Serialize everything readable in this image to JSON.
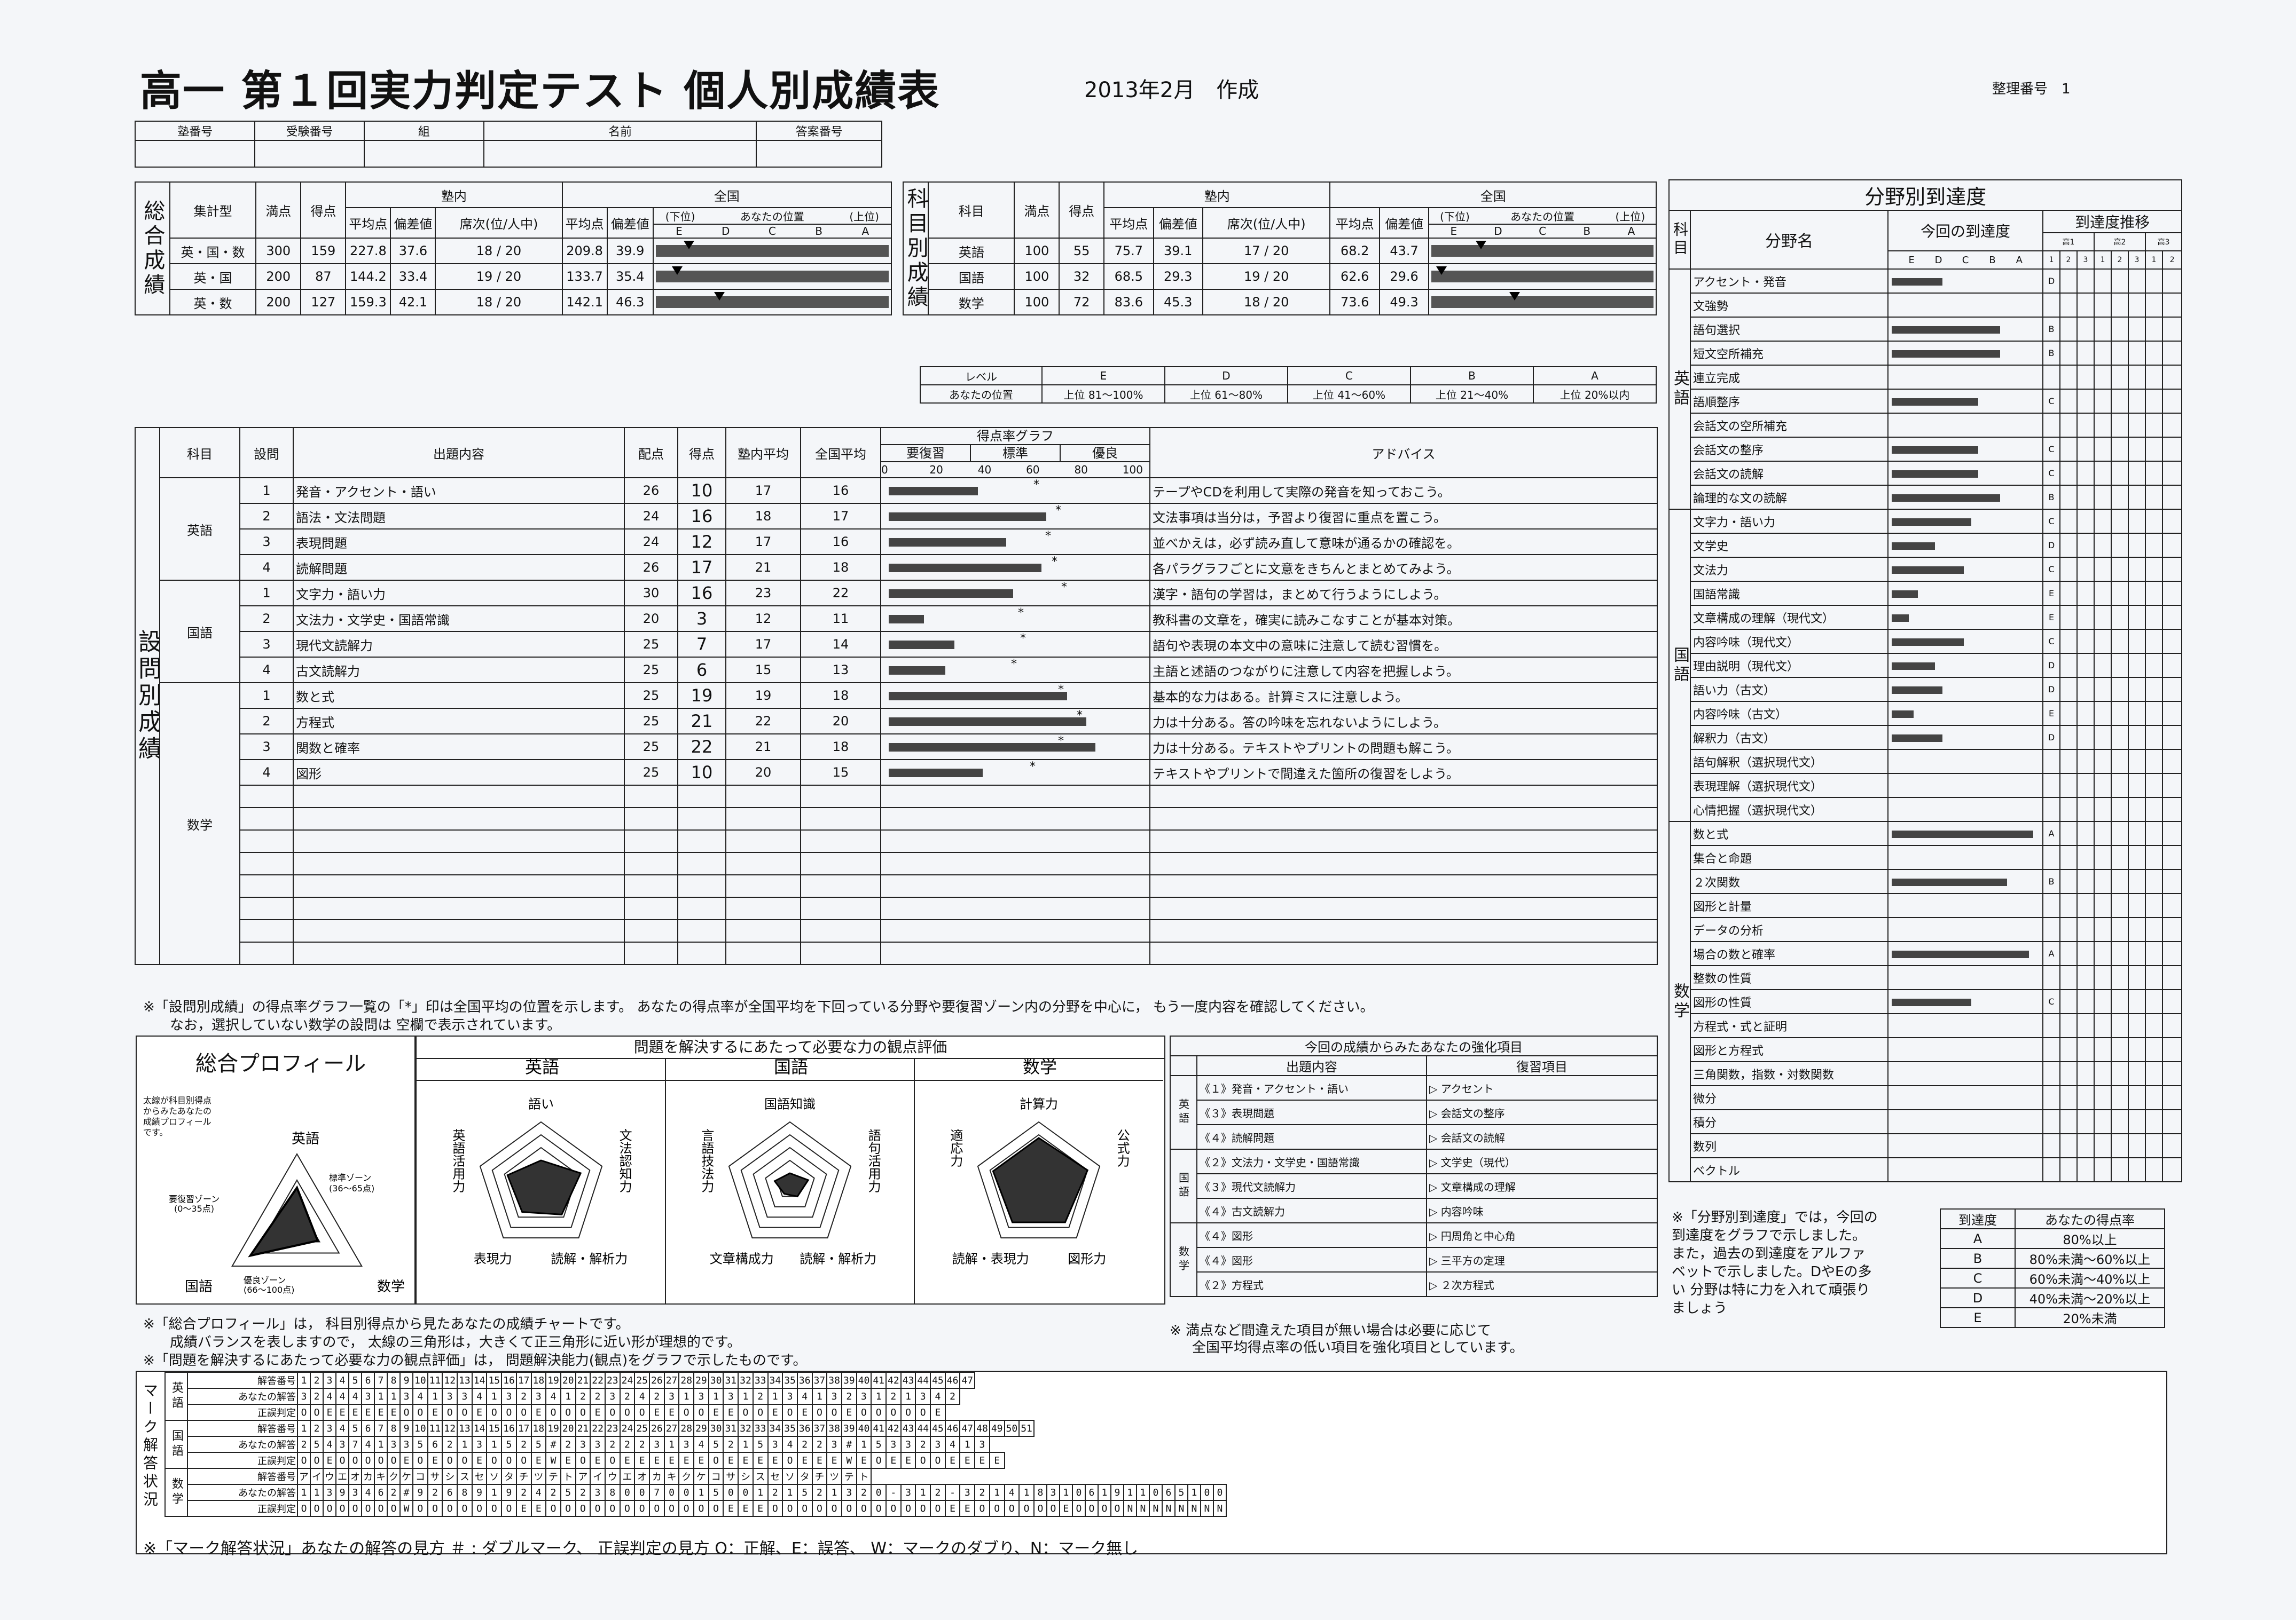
{
  "header": {
    "title": "高一 第１回実力判定テスト 個人別成績表",
    "date": "2013年2月　作成",
    "ref_label": "整理番号",
    "ref_value": "1"
  },
  "id_fields": [
    "塾番号",
    "受験番号",
    "組",
    "名前",
    "答案番号"
  ],
  "total": {
    "side": "総合成績",
    "h": [
      "集計型",
      "満点",
      "得点",
      "塾内",
      "全国",
      "平均点",
      "偏差値",
      "席次(位/人中)",
      "あなたの位置",
      "(下位)",
      "(上位)"
    ],
    "grades": [
      "E",
      "D",
      "C",
      "B",
      "A"
    ],
    "rows": [
      {
        "type": "英・国・数",
        "full": "300",
        "score": "159",
        "avg": "227.8",
        "dev": "37.6",
        "rank": "18 / 20",
        "navg": "209.8",
        "ndev": "39.9",
        "pos": 0.12
      },
      {
        "type": "英・国",
        "full": "200",
        "score": "87",
        "avg": "144.2",
        "dev": "33.4",
        "rank": "19 / 20",
        "navg": "133.7",
        "ndev": "35.4",
        "pos": 0.07
      },
      {
        "type": "英・数",
        "full": "200",
        "score": "127",
        "avg": "159.3",
        "dev": "42.1",
        "rank": "18 / 20",
        "navg": "142.1",
        "ndev": "46.3",
        "pos": 0.25
      }
    ]
  },
  "subj": {
    "side": "科目別成績",
    "h_subject": "科目",
    "rows": [
      {
        "name": "英語",
        "full": "100",
        "score": "55",
        "avg": "75.7",
        "dev": "39.1",
        "rank": "17 / 20",
        "navg": "68.2",
        "ndev": "43.7",
        "pos": 0.2
      },
      {
        "name": "国語",
        "full": "100",
        "score": "32",
        "avg": "68.5",
        "dev": "29.3",
        "rank": "19 / 20",
        "navg": "62.6",
        "ndev": "29.6",
        "pos": 0.02
      },
      {
        "name": "数学",
        "full": "100",
        "score": "72",
        "avg": "83.6",
        "dev": "45.3",
        "rank": "18 / 20",
        "navg": "73.6",
        "ndev": "49.3",
        "pos": 0.35
      }
    ]
  },
  "level": {
    "h": "レベル",
    "pos_label": "あなたの位置",
    "grades": [
      "E",
      "D",
      "C",
      "B",
      "A"
    ],
    "ranges": [
      "上位 81～100%",
      "上位 61～80%",
      "上位 41～60%",
      "上位 21～40%",
      "上位 20%以内"
    ]
  },
  "q": {
    "side": "設問別成績",
    "h": [
      "科目",
      "設問",
      "出題内容",
      "配点",
      "得点",
      "塾内平均",
      "全国平均",
      "得点率グラフ",
      "アドバイス"
    ],
    "zones": [
      "要復習",
      "標準",
      "優良"
    ],
    "ticks": [
      "0",
      "20",
      "40",
      "60",
      "80",
      "100"
    ],
    "rows": [
      {
        "subj": "英語",
        "n": "1",
        "c": "発音・アクセント・語い",
        "pts": "26",
        "s": "10",
        "a": "17",
        "na": "16",
        "r": 38,
        "adv": "テープやCDを利用して実際の発音を知っておこう。"
      },
      {
        "subj": "",
        "n": "2",
        "c": "語法・文法問題",
        "pts": "24",
        "s": "16",
        "a": "18",
        "na": "17",
        "r": 67,
        "adv": "文法事項は当分は，予習より復習に重点を置こう。"
      },
      {
        "subj": "",
        "n": "3",
        "c": "表現問題",
        "pts": "24",
        "s": "12",
        "a": "17",
        "na": "16",
        "r": 50,
        "adv": "並べかえは，必ず読み直して意味が通るかの確認を。"
      },
      {
        "subj": "",
        "n": "4",
        "c": "読解問題",
        "pts": "26",
        "s": "17",
        "a": "21",
        "na": "18",
        "r": 65,
        "adv": "各パラグラフごとに文意をきちんとまとめてみよう。"
      },
      {
        "subj": "国語",
        "n": "1",
        "c": "文字力・語い力",
        "pts": "30",
        "s": "16",
        "a": "23",
        "na": "22",
        "r": 53,
        "adv": "漢字・語句の学習は，まとめて行うようにしよう。"
      },
      {
        "subj": "",
        "n": "2",
        "c": "文法力・文学史・国語常識",
        "pts": "20",
        "s": "3",
        "a": "12",
        "na": "11",
        "r": 15,
        "adv": "教科書の文章を，確実に読みこなすことが基本対策。"
      },
      {
        "subj": "",
        "n": "3",
        "c": "現代文読解力",
        "pts": "25",
        "s": "7",
        "a": "17",
        "na": "14",
        "r": 28,
        "adv": "語句や表現の本文中の意味に注意して読む習慣を。"
      },
      {
        "subj": "",
        "n": "4",
        "c": "古文読解力",
        "pts": "25",
        "s": "6",
        "a": "15",
        "na": "13",
        "r": 24,
        "adv": "主語と述語のつながりに注意して内容を把握しよう。"
      },
      {
        "subj": "数学",
        "n": "1",
        "c": "数と式",
        "pts": "25",
        "s": "19",
        "a": "19",
        "na": "18",
        "r": 76,
        "adv": "基本的な力はある。計算ミスに注意しよう。"
      },
      {
        "subj": "",
        "n": "2",
        "c": "方程式",
        "pts": "25",
        "s": "21",
        "a": "22",
        "na": "20",
        "r": 84,
        "adv": "力は十分ある。答の吟味を忘れないようにしよう。"
      },
      {
        "subj": "",
        "n": "3",
        "c": "関数と確率",
        "pts": "25",
        "s": "22",
        "a": "21",
        "na": "18",
        "r": 88,
        "adv": "力は十分ある。テキストやプリントの問題も解こう。"
      },
      {
        "subj": "",
        "n": "4",
        "c": "図形",
        "pts": "25",
        "s": "10",
        "a": "20",
        "na": "15",
        "r": 40,
        "adv": "テキストやプリントで間違えた箇所の復習をしよう。"
      }
    ]
  },
  "q_notes": [
    "※「設問別成績」の得点率グラフ一覧の「*」印は全国平均の位置を示します。 あなたの得点率が全国平均を下回っている分野や要復習ゾーン内の分野を中心に， もう一度内容を確認してください。",
    "なお，選択していない数学の設問は 空欄で表示されています。"
  ],
  "field": {
    "title": "分野別到達度",
    "h_subj": "科目",
    "h_name": "分野名",
    "h_now": "今回の到達度",
    "h_trend": "到達度推移",
    "trend_h": [
      "高1",
      "高2",
      "高3"
    ],
    "trend_sub": [
      "1",
      "2",
      "3",
      "1",
      "2",
      "3",
      "1",
      "2"
    ],
    "grades": [
      "E",
      "D",
      "C",
      "B",
      "A"
    ],
    "groups": [
      {
        "subj": "英語",
        "items": [
          {
            "n": "アクセント・発音",
            "v": 0.35,
            "g": "D"
          },
          {
            "n": "文強勢",
            "v": 0,
            "g": ""
          },
          {
            "n": "語句選択",
            "v": 0.75,
            "g": "B"
          },
          {
            "n": "短文空所補充",
            "v": 0.75,
            "g": "B"
          },
          {
            "n": "連立完成",
            "v": 0,
            "g": ""
          },
          {
            "n": "語順整序",
            "v": 0.6,
            "g": "C"
          },
          {
            "n": "会話文の空所補充",
            "v": 0,
            "g": ""
          },
          {
            "n": "会話文の整序",
            "v": 0.6,
            "g": "C"
          },
          {
            "n": "会話文の読解",
            "v": 0.6,
            "g": "C"
          },
          {
            "n": "論理的な文の読解",
            "v": 0.75,
            "g": "B"
          }
        ]
      },
      {
        "subj": "国語",
        "items": [
          {
            "n": "文字力・語い力",
            "v": 0.55,
            "g": "C"
          },
          {
            "n": "文学史",
            "v": 0.3,
            "g": "D"
          },
          {
            "n": "文法力",
            "v": 0.5,
            "g": "C"
          },
          {
            "n": "国語常識",
            "v": 0.18,
            "g": "E"
          },
          {
            "n": "文章構成の理解（現代文）",
            "v": 0.12,
            "g": "E"
          },
          {
            "n": "内容吟味（現代文）",
            "v": 0.5,
            "g": "C"
          },
          {
            "n": "理由説明（現代文）",
            "v": 0.3,
            "g": "D"
          },
          {
            "n": "語い力（古文）",
            "v": 0.35,
            "g": "D"
          },
          {
            "n": "内容吟味（古文）",
            "v": 0.15,
            "g": "E"
          },
          {
            "n": "解釈力（古文）",
            "v": 0.35,
            "g": "D"
          },
          {
            "n": "語句解釈（選択現代文）",
            "v": 0,
            "g": ""
          },
          {
            "n": "表現理解（選択現代文）",
            "v": 0,
            "g": ""
          },
          {
            "n": "心情把握（選択現代文）",
            "v": 0,
            "g": ""
          }
        ]
      },
      {
        "subj": "数学",
        "items": [
          {
            "n": "数と式",
            "v": 0.98,
            "g": "A"
          },
          {
            "n": "集合と命題",
            "v": 0,
            "g": ""
          },
          {
            "n": "２次関数",
            "v": 0.8,
            "g": "B"
          },
          {
            "n": "図形と計量",
            "v": 0,
            "g": ""
          },
          {
            "n": "データの分析",
            "v": 0,
            "g": ""
          },
          {
            "n": "場合の数と確率",
            "v": 0.95,
            "g": "A"
          },
          {
            "n": "整数の性質",
            "v": 0,
            "g": ""
          },
          {
            "n": "図形の性質",
            "v": 0.55,
            "g": "C"
          },
          {
            "n": "方程式・式と証明",
            "v": 0,
            "g": ""
          },
          {
            "n": "図形と方程式",
            "v": 0,
            "g": ""
          },
          {
            "n": "三角関数，指数・対数関数",
            "v": 0,
            "g": ""
          },
          {
            "n": "微分",
            "v": 0,
            "g": ""
          },
          {
            "n": "積分",
            "v": 0,
            "g": ""
          },
          {
            "n": "数列",
            "v": 0,
            "g": ""
          },
          {
            "n": "ベクトル",
            "v": 0,
            "g": ""
          }
        ]
      }
    ],
    "note": [
      "※「分野別到達度」では，今回の",
      "到達度をグラフで示しました。",
      "また，過去の到達度をアルファ",
      "ベットで示しました。DやEの多",
      "い 分野は特に力を入れて頑張り",
      "ましょう"
    ],
    "legend_h": [
      "到達度",
      "あなたの得点率"
    ],
    "legend": [
      [
        "A",
        "80%以上"
      ],
      [
        "B",
        "80%未満～60%以上"
      ],
      [
        "C",
        "60%未満～40%以上"
      ],
      [
        "D",
        "40%未満～20%以上"
      ],
      [
        "E",
        "20%未満"
      ]
    ]
  },
  "profile": {
    "title": "総合プロフィール",
    "desc": [
      "太線が科目別得点",
      "からみたあなたの",
      "成績プロフィール",
      "です。"
    ],
    "labels": [
      "英語",
      "国語",
      "数学"
    ],
    "zones": [
      "標準ゾーン",
      "(36～65点)",
      "要復習ゾーン",
      "(0～35点)",
      "優良ゾーン",
      "(66～100点)"
    ],
    "values": [
      0.55,
      0.32,
      0.72
    ]
  },
  "ability": {
    "title": "問題を解決するにあたって必要な力の観点評価",
    "charts": [
      {
        "subj": "英語",
        "labels": [
          "語い",
          "文法認知力",
          "読解・解析力",
          "表現力",
          "英語活用力"
        ],
        "v": [
          0.4,
          0.65,
          0.55,
          0.5,
          0.55
        ]
      },
      {
        "subj": "国語",
        "labels": [
          "国語知識",
          "語句活用力",
          "読解・解析力",
          "文章構成力",
          "言語技法力"
        ],
        "v": [
          0.2,
          0.3,
          0.2,
          0.15,
          0.25
        ]
      },
      {
        "subj": "数学",
        "labels": [
          "計算力",
          "公式力",
          "図形力",
          "読解・表現力",
          "適応力"
        ],
        "v": [
          0.75,
          0.8,
          0.7,
          0.7,
          0.75
        ]
      }
    ]
  },
  "strength": {
    "title": "今回の成績からみたあなたの強化項目",
    "h": [
      "出題内容",
      "復習項目"
    ],
    "groups": [
      {
        "subj": "英語",
        "rows": [
          [
            "《１》発音・アクセント・語い",
            "アクセント"
          ],
          [
            "《３》表現問題",
            "会話文の整序"
          ],
          [
            "《４》読解問題",
            "会話文の読解"
          ]
        ]
      },
      {
        "subj": "国語",
        "rows": [
          [
            "《２》文法力・文学史・国語常識",
            "文学史（現代）"
          ],
          [
            "《３》現代文読解力",
            "文章構成の理解"
          ],
          [
            "《４》古文読解力",
            "内容吟味"
          ]
        ]
      },
      {
        "subj": "数学",
        "rows": [
          [
            "《４》図形",
            "円周角と中心角"
          ],
          [
            "《４》図形",
            "三平方の定理"
          ],
          [
            "《２》方程式",
            "２次方程式"
          ]
        ]
      }
    ],
    "notes": [
      "※ 満点など間違えた項目が無い場合は必要に応じて",
      "全国平均得点率の低い項目を強化項目としています。"
    ]
  },
  "profile_notes": [
    "※「総合プロフィール」は， 科目別得点から見たあなたの成績チャートです。",
    "成績バランスを表しますので， 太線の三角形は，大きくて正三角形に近い形が理想的です。",
    "※「問題を解決するにあたって必要な力の観点評価」は， 問題解決能力(観点)をグラフで示したものです。"
  ],
  "mark": {
    "side": "マーク解答状況",
    "labels": [
      "解答番号",
      "あなたの解答",
      "正誤判定"
    ],
    "subjects": [
      {
        "subj": "英語",
        "nums": "1 2 3 4 5 6 7 8 9 10 11 12 13 14 15 16 17 18 19 20 21 22 23 24 25 26 27 28 29 30 31 32 33 34 35 36 37 38 39 40 41 42 43 44 45 46 47",
        "ans": "3 2 4 4 4 3 1 1 3 4 1 3 3 4 1 3 2 3 4 1 2 2 3 2 4 2 3 1 3 1 3 1 2 1 3 4 1 3 2 3 1 2 1 3 4 2",
        "judge": "O O E E E E E E O O E O O E O O O E O O O E O O O E E O O E E O O E O E O O E O O O O O E"
      },
      {
        "subj": "国語",
        "nums": "1 2 3 4 5 6 7 8 9 10 11 12 13 14 15 16 17 18 19 20 21 22 23 24 25 26 27 28 29 30 31 32 33 34 35 36 37 38 39 40 41 42 43 44 45 46 47 48 49 50 51",
        "ans": "2 5 4 3 7 4 1 3 3 5 6 2 1 3 1 5 2 5 # 2 3 3 2 2 2 3 1 3 4 5 2 1 5 3 4 2 2 3 # 1 5 3 3 2 3 4 1 3",
        "judge": "O O E O O O O O E O E O O E O O O E W E O E O E E E E E E O E E E E O E E E W E O E E O O E E E E"
      },
      {
        "subj": "数学",
        "nums": "ア イ ウ エ オ カ キ ク ケ コ サ シ ス セ ソ タ チ ツ テ ト ア イ ウ エ オ カ キ ク ケ コ サ シ ス セ ソ タ チ ツ テ ト",
        "ans": "1 1 3 9 3 4 6 2 # 9 2 6 8 9 1 9 2 4 2 5 2 3 8 0 0 7 0 0 1 5 0 0 1 2 1 5 2 1 3 2 0 - 3 1 2 - 3 2 1 4 1 8 3 1 0 6 1 9 1 1 0 6 5 1 0 0",
        "judge": "O O O O O O O O W O O O O O O O E E O O O O O O O O O O O O E E E O O O O O O O O O O O O E E O O O O O O E O O O O N N N N N N N N"
      }
    ]
  },
  "mark_note": "※「マーク解答状況」あなたの解答の見方 ＃ : ダブルマーク、 正誤判定の見方 O：正解、E：誤答、 W：マークのダブり、N：マーク無し"
}
